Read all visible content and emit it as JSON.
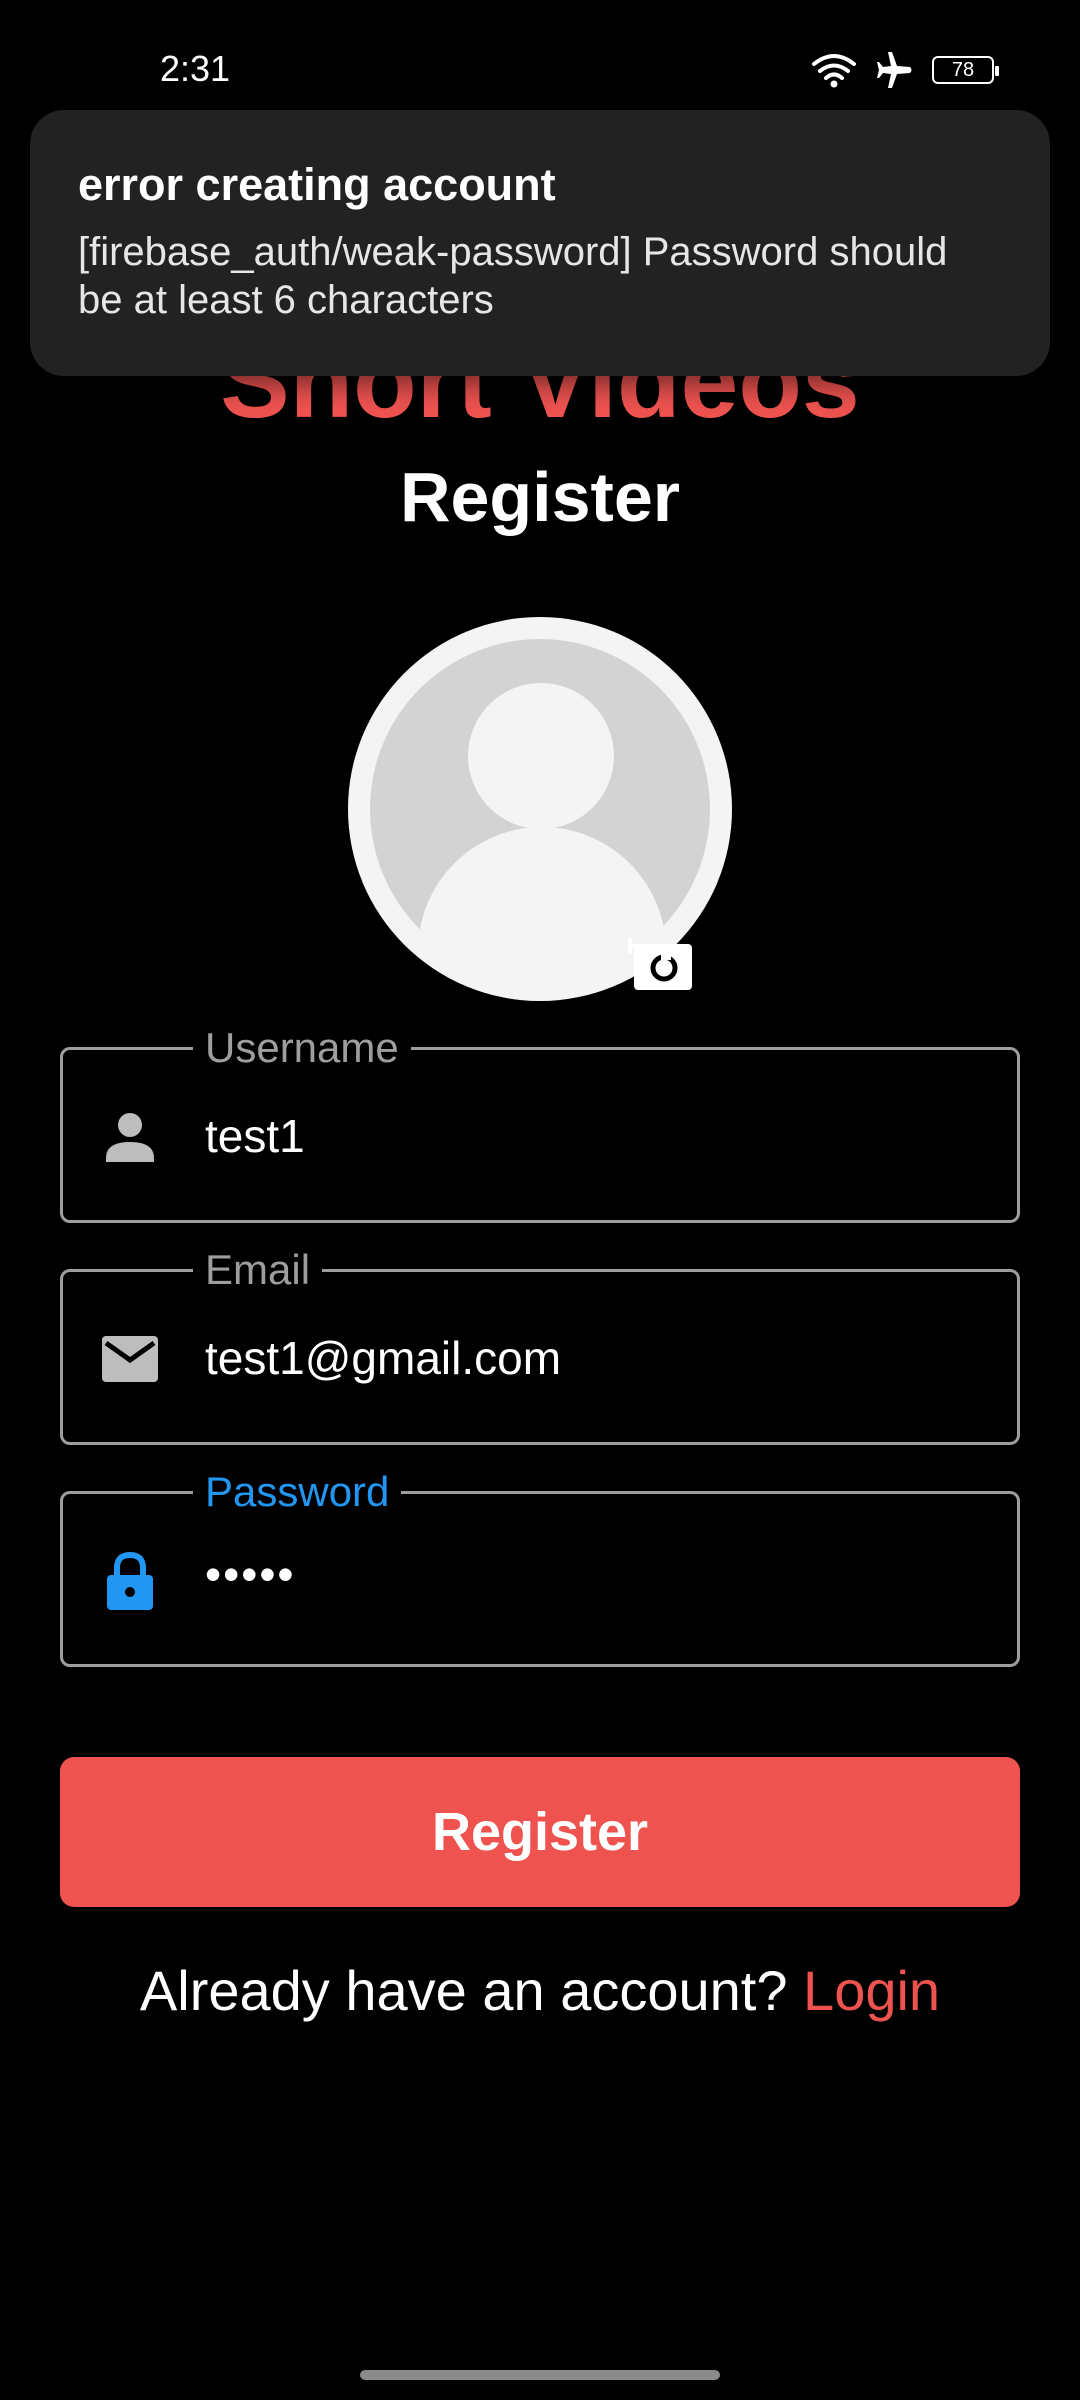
{
  "status_bar": {
    "time": "2:31",
    "battery_level": "78"
  },
  "app": {
    "title": "Short Videos",
    "page_title": "Register"
  },
  "toast": {
    "title": "error creating account",
    "message": "[firebase_auth/weak-password] Password should be at least 6 characters"
  },
  "form": {
    "username": {
      "label": "Username",
      "value": "test1",
      "icon": "person-icon"
    },
    "email": {
      "label": "Email",
      "value": "test1@gmail.com",
      "icon": "mail-icon"
    },
    "password": {
      "label": "Password",
      "value": "•••••",
      "icon": "lock-icon",
      "focused": true
    }
  },
  "register_button": {
    "label": "Register"
  },
  "login_prompt": {
    "text": "Already have an account?",
    "link": "Login"
  },
  "colors": {
    "accent": "#ef5350",
    "focus": "#2196f3",
    "border": "#9e9e9e",
    "toast_bg": "#222222"
  }
}
